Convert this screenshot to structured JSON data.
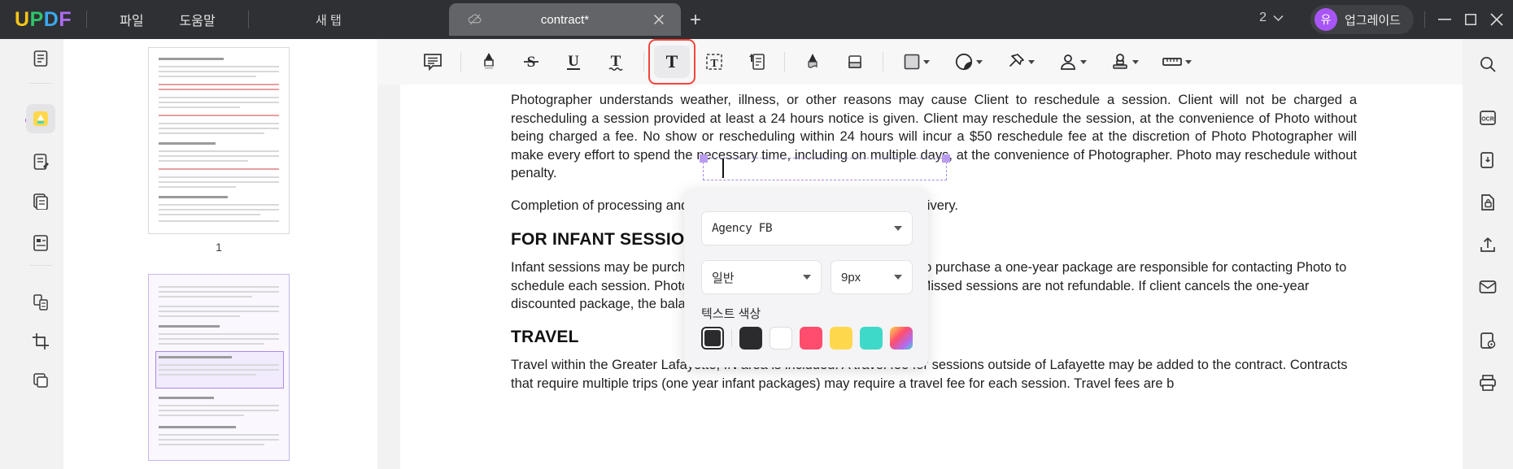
{
  "app": {
    "brand": "UPDF",
    "brand_letters": [
      "U",
      "P",
      "D",
      "F"
    ],
    "brand_colors": [
      "#f5c518",
      "#2ec46b",
      "#3aa8f0",
      "#b06cf2"
    ]
  },
  "titlebar": {
    "menus": [
      {
        "label": "파일",
        "name": "menu-file"
      },
      {
        "label": "도움말",
        "name": "menu-help"
      }
    ],
    "new_tab_label": "새 탭",
    "tab": {
      "title": "contract*",
      "cloud_icon": "cloud-offline-icon",
      "close_icon": "close-icon"
    },
    "add_tab_icon": "plus-icon",
    "page_count": "2",
    "page_count_caret": "chevron-down-icon",
    "upgrade_label": "업그레이드",
    "avatar_initial": "유",
    "avatar_color": "#a855f7",
    "window_controls": {
      "minimize": "—",
      "maximize": "▢",
      "close": "✕"
    }
  },
  "left_rail": {
    "items": [
      {
        "name": "sidebar-reader-icon",
        "icon": "document-icon",
        "active": false
      },
      {
        "name": "sidebar-annotate-icon",
        "icon": "highlighter-icon",
        "active": true
      },
      {
        "name": "sidebar-edit-pdf-icon",
        "icon": "edit-document-icon",
        "active": false
      },
      {
        "name": "sidebar-page-edit-icon",
        "icon": "pages-icon",
        "active": false
      },
      {
        "name": "sidebar-form-icon",
        "icon": "form-icon",
        "active": false
      },
      {
        "name": "sidebar-convert-icon",
        "icon": "convert-icon",
        "active": false
      },
      {
        "name": "sidebar-crop-icon",
        "icon": "crop-icon",
        "active": false
      },
      {
        "name": "sidebar-organize-icon",
        "icon": "layers-icon",
        "active": false
      }
    ]
  },
  "thumbnails": {
    "pages": [
      {
        "number": "1",
        "selected": false
      },
      {
        "number": "",
        "selected": true
      }
    ],
    "page1_label": "1"
  },
  "toolbar": {
    "groups": [
      {
        "items": [
          {
            "name": "comment-tool",
            "icon": "comment-bubble-icon",
            "active": false
          }
        ]
      },
      {
        "items": [
          {
            "name": "highlight-tool",
            "icon": "highlighter-icon",
            "active": false
          },
          {
            "name": "strikethrough-tool",
            "icon": "strikethrough-icon",
            "active": false
          },
          {
            "name": "underline-tool",
            "icon": "underline-icon",
            "active": false
          },
          {
            "name": "squiggly-tool",
            "icon": "squiggly-underline-icon",
            "active": false
          }
        ]
      },
      {
        "items": [
          {
            "name": "add-text-tool",
            "icon": "text-icon",
            "active": true,
            "highlighted": true
          },
          {
            "name": "text-box-tool",
            "icon": "text-box-icon",
            "active": false
          },
          {
            "name": "sticky-note-tool",
            "icon": "note-callout-icon",
            "active": false
          }
        ]
      },
      {
        "items": [
          {
            "name": "pencil-tool",
            "icon": "pencil-icon",
            "active": false
          },
          {
            "name": "eraser-tool",
            "icon": "eraser-icon",
            "active": false
          }
        ]
      },
      {
        "items": [
          {
            "name": "shape-tool",
            "icon": "square-shape-icon",
            "active": false,
            "caret": true
          },
          {
            "name": "sticker-tool",
            "icon": "sticker-icon",
            "active": false,
            "caret": true
          },
          {
            "name": "pin-tool",
            "icon": "pushpin-icon",
            "active": false,
            "caret": true
          },
          {
            "name": "signature-tool",
            "icon": "signature-person-icon",
            "active": false,
            "caret": true
          },
          {
            "name": "stamp-tool",
            "icon": "stamp-icon",
            "active": false,
            "caret": true
          },
          {
            "name": "measure-tool",
            "icon": "ruler-icon",
            "active": false,
            "caret": true
          }
        ]
      }
    ]
  },
  "document": {
    "paragraph1": "Photographer understands weather, illness, or other reasons may cause Client to reschedule a session. Client will not be charged a rescheduling a session provided at least a 24 hours notice is given. Client may reschedule the session, at the convenience of Photo without being charged a fee. No show or rescheduling within 24 hours will incur a $50 reschedule fee at the discretion of Photo Photographer will make every effort to spend the necessary time, including on multiple days, at the convenience of Photographer. Photo may reschedule without penalty.",
    "paragraph2": "Completion of processing and edits of images takes 4–6 weeks for delivery.",
    "heading1": "FOR INFANT SESSIONS",
    "paragraph3": "Infant sessions may be purchased as a one-year package. Clients who purchase a one-year package are responsible for contacting Photo to schedule each session. Photographer will not reach out to schedule. Missed sessions are not refundable. If client cancels the one-year discounted package, the balance will be due at the regular rate.",
    "heading2": "TRAVEL",
    "paragraph4": "Travel within the Greater Lafayette, IN area is included. A travel fee for sessions outside of Lafayette may be added to the contract. Contracts that require multiple trips (one year infant packages) may require a travel fee for each session. Travel fees are b"
  },
  "font_panel": {
    "font_family": "Agency FB",
    "font_style": "일반",
    "font_size": "9px",
    "text_color_label": "텍스트 색상",
    "swatches": [
      {
        "name": "swatch-black-selected",
        "color": "#2b2b2e",
        "selected": true
      },
      {
        "name": "swatch-black",
        "color": "#2b2b2e",
        "selected": false
      },
      {
        "name": "swatch-white",
        "color": "#ffffff",
        "selected": false
      },
      {
        "name": "swatch-pink",
        "color": "#ff4d6d",
        "selected": false
      },
      {
        "name": "swatch-yellow",
        "color": "#ffd84d",
        "selected": false
      },
      {
        "name": "swatch-teal",
        "color": "#3fd9c9",
        "selected": false
      },
      {
        "name": "swatch-gradient",
        "color": "#b06cf2",
        "selected": false
      }
    ]
  },
  "right_rail": {
    "items": [
      {
        "name": "search-icon",
        "icon": "magnifier-icon"
      },
      {
        "name": "ocr-icon",
        "icon": "ocr-icon",
        "label": "OCR"
      },
      {
        "name": "compress-icon",
        "icon": "compress-icon"
      },
      {
        "name": "protect-icon",
        "icon": "protect-document-icon"
      },
      {
        "name": "share-icon",
        "icon": "share-upload-icon"
      },
      {
        "name": "email-icon",
        "icon": "envelope-icon"
      },
      {
        "name": "batch-icon",
        "icon": "batch-process-icon"
      },
      {
        "name": "print-icon",
        "icon": "printer-icon"
      }
    ]
  }
}
